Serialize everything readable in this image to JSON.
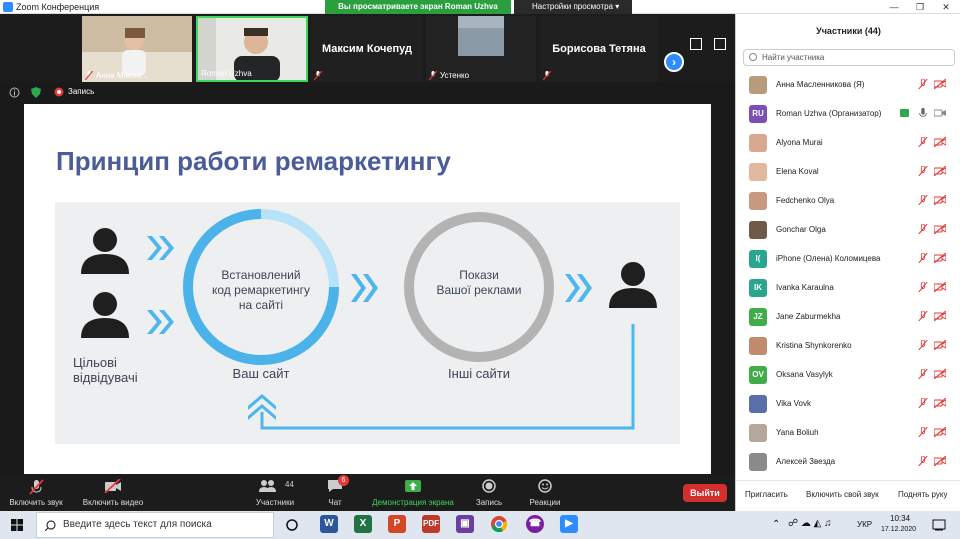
{
  "window": {
    "title": "Zoom Конференция",
    "banner": "Вы просматриваете экран Roman Uzhva",
    "view_settings": "Настройки просмотра"
  },
  "thumbnails": [
    {
      "name": "Анна Масле...",
      "muted": true
    },
    {
      "name": "Roman Uzhva",
      "muted": false
    },
    {
      "name": "Максим Кочепуд",
      "muted": true
    },
    {
      "name": "Устенко",
      "muted": true
    },
    {
      "name": "Борисова Тетяна",
      "muted": true
    }
  ],
  "share": {
    "recording_label": "Запись"
  },
  "slide": {
    "title": "Принцип работи ремаркетингу",
    "visitors_label": "Цільові відвідувачі",
    "circle1_text": "Встановлений код ремаркетингу на сайті",
    "circle1_caption": "Ваш сайт",
    "circle2_text": "Покази Вашої реклами",
    "circle2_caption": "Інші сайти",
    "visitors_line1": "Цільові",
    "visitors_line2": "відвідувачі",
    "c1_line1": "Встановлений",
    "c1_line2": "код ремаркетингу",
    "c1_line3": "на сайті",
    "c2_line1": "Покази",
    "c2_line2": "Вашої реклами"
  },
  "controls": {
    "audio": "Включить звук",
    "video": "Включить видео",
    "participants": "Участники",
    "participants_count": "44",
    "chat": "Чат",
    "chat_badge": "6",
    "share": "Демонстрация экрана",
    "record": "Запись",
    "reactions": "Реакции",
    "leave": "Выйти"
  },
  "panel": {
    "title": "Участники (44)",
    "search_placeholder": "Найти участника",
    "participants": [
      {
        "name": "Анна Масленникова (Я)",
        "avatar": "photo",
        "color": "#b89a7c"
      },
      {
        "name": "Roman Uzhva (Организатор)",
        "avatar": "RU",
        "color": "#7b4fb6"
      },
      {
        "name": "Alyona Murai",
        "avatar": "photo",
        "color": "#d8a98f"
      },
      {
        "name": "Elena Koval",
        "avatar": "photo",
        "color": "#e0b9a0"
      },
      {
        "name": "Fedchenko Olya",
        "avatar": "photo",
        "color": "#c79a80"
      },
      {
        "name": "Gonchar Olga",
        "avatar": "photo",
        "color": "#6f5a4a"
      },
      {
        "name": "iPhone (Олена) Коломицева",
        "avatar": "I(",
        "color": "#2aa58f"
      },
      {
        "name": "Ivanka Karaulna",
        "avatar": "IK",
        "color": "#2aa58f"
      },
      {
        "name": "Jane Zaburmekha",
        "avatar": "JZ",
        "color": "#3fae49"
      },
      {
        "name": "Kristina Shynkorenko",
        "avatar": "photo",
        "color": "#c28c6c"
      },
      {
        "name": "Oksana Vasylyk",
        "avatar": "OV",
        "color": "#3fae49"
      },
      {
        "name": "Vika Vovk",
        "avatar": "photo",
        "color": "#5a6fa8"
      },
      {
        "name": "Yana Boliuh",
        "avatar": "photo",
        "color": "#b7a79a"
      },
      {
        "name": "Алексей Звезда",
        "avatar": "photo",
        "color": "#8a8a8a"
      }
    ],
    "invite": "Пригласить",
    "unmute_me": "Включить свой звук",
    "raise_hand": "Поднять руку"
  },
  "taskbar": {
    "search_placeholder": "Введите здесь текст для поиска",
    "language": "УКР",
    "time": "10:34",
    "date": "17.12.2020"
  },
  "colors": {
    "accent": "#2d8cff",
    "green": "#2b9e3e",
    "leave": "#d32f2f",
    "slide_blue": "#4a5d9a",
    "arrow_blue": "#5bc0eb"
  }
}
